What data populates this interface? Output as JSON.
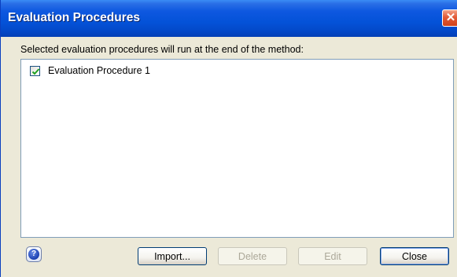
{
  "window": {
    "title": "Evaluation Procedures",
    "close_glyph": "✕"
  },
  "instruction": "Selected evaluation procedures will run at the end of the method:",
  "procedures": [
    {
      "label": "Evaluation Procedure 1",
      "checked": true
    }
  ],
  "buttons": {
    "help_glyph": "?",
    "import": "Import...",
    "delete": "Delete",
    "edit": "Edit",
    "close": "Close"
  },
  "colors": {
    "titlebar": "#0452d8",
    "dialog_bg": "#ece9d8",
    "close_red": "#d0421c",
    "check_green": "#21a121"
  }
}
